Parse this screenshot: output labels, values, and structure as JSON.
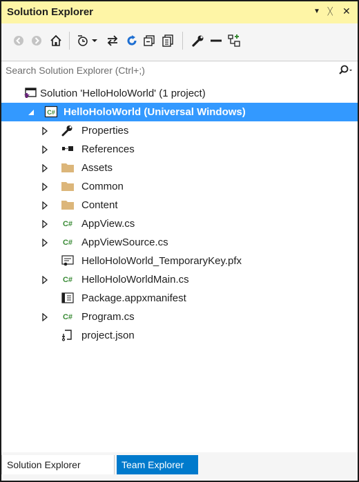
{
  "panel": {
    "title": "Solution Explorer",
    "controls": {
      "dropdown": "▼",
      "pin": "ᚷ",
      "close": "✕"
    }
  },
  "search": {
    "placeholder": "Search Solution Explorer (Ctrl+;)"
  },
  "tree": {
    "solution": "Solution 'HelloHoloWorld' (1 project)",
    "project": "HelloHoloWorld (Universal Windows)",
    "items": [
      {
        "label": "Properties",
        "icon": "wrench-icon",
        "expandable": true
      },
      {
        "label": "References",
        "icon": "references-icon",
        "expandable": true
      },
      {
        "label": "Assets",
        "icon": "folder-icon",
        "expandable": true
      },
      {
        "label": "Common",
        "icon": "folder-icon",
        "expandable": true
      },
      {
        "label": "Content",
        "icon": "folder-icon",
        "expandable": true
      },
      {
        "label": "AppView.cs",
        "icon": "csharp-file-icon",
        "expandable": true
      },
      {
        "label": "AppViewSource.cs",
        "icon": "csharp-file-icon",
        "expandable": true
      },
      {
        "label": "HelloHoloWorld_TemporaryKey.pfx",
        "icon": "certificate-icon",
        "expandable": false
      },
      {
        "label": "HelloHoloWorldMain.cs",
        "icon": "csharp-file-icon",
        "expandable": true
      },
      {
        "label": "Package.appxmanifest",
        "icon": "manifest-icon",
        "expandable": false
      },
      {
        "label": "Program.cs",
        "icon": "csharp-file-icon",
        "expandable": true
      },
      {
        "label": "project.json",
        "icon": "json-file-icon",
        "expandable": false
      }
    ]
  },
  "tabs": [
    {
      "label": "Solution Explorer",
      "active": true
    },
    {
      "label": "Team Explorer",
      "active": false
    }
  ],
  "colors": {
    "title_bg": "#fef5a6",
    "selection": "#3399ff",
    "tab_inactive": "#007acc",
    "folder": "#dcb67a",
    "csharp": "#388a34"
  }
}
